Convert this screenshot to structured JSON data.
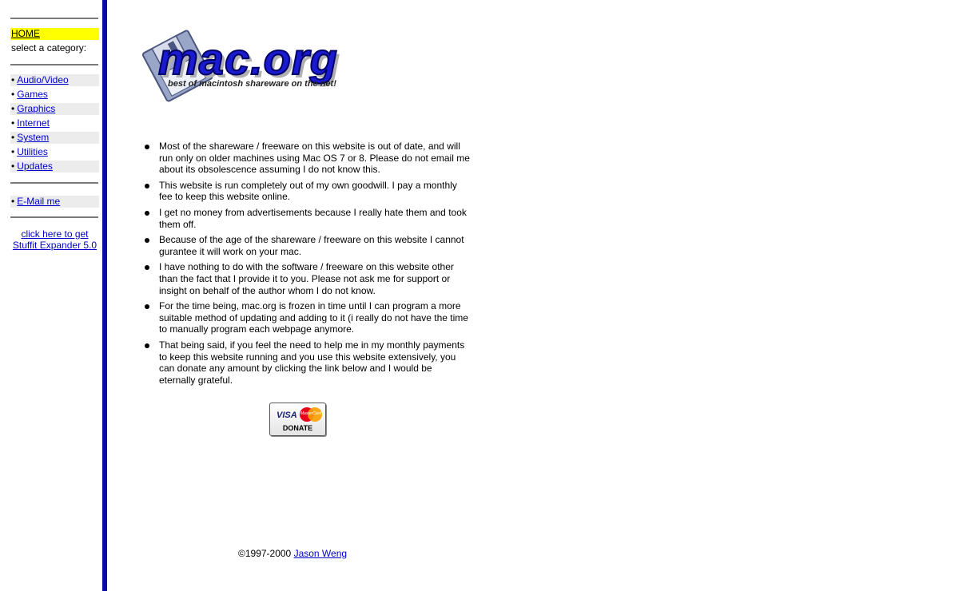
{
  "sidebar": {
    "home_label": "HOME",
    "select_label": "select a category:",
    "bullet": "•",
    "categories": [
      {
        "label": "Audio/Video"
      },
      {
        "label": "Games"
      },
      {
        "label": "Graphics"
      },
      {
        "label": "Internet"
      },
      {
        "label": "System"
      },
      {
        "label": "Utilities"
      },
      {
        "label": "Updates"
      }
    ],
    "email_label": "E-Mail me",
    "stuffit_line1": "click here to get",
    "stuffit_line2": "Stuffit Expander 5.0"
  },
  "logo": {
    "text": "mac.org",
    "tagline": "best of macintosh shareware on the net!",
    "icon": "floppy-disk-icon"
  },
  "notes": [
    "Most of the shareware / freeware on this website is out of date, and will run only on older machines using Mac OS 7 or 8. Please do not email me about its obsolescence assuming I do not know this.",
    "This website is run completely out of my own goodwill. I pay a monthly fee to keep this website online.",
    "I get no money from advertisements because I really hate them and took them off.",
    "Because of the age of the shareware / freeware on this website I cannot gurantee it will work on your mac.",
    "I have nothing to do with the software / freeware on this website other than the fact that I provide it to you. Please not ask me for support or insight on behalf of the author whom I do not know.",
    "For the time being, mac.org is frozen in time until I can program a more suitable method of updating and adding to it (i really do not have the time to manually program each webpage anymore.",
    "That being said, if you feel the need to help me in my monthly payments to keep this website running and you use this website extensively, you can donate any amount by clicking the link below and I would be eternally grateful."
  ],
  "donate": {
    "visa": "VISA",
    "mastercard": "MasterCard",
    "label": "DONATE"
  },
  "footer": {
    "copyright": "©1997-2000",
    "author": "Jason Weng"
  },
  "colors": {
    "sidebar_border": "#0a0aa8",
    "home_highlight": "#ffff00",
    "link": "#0000cc",
    "logo_blue": "#1a1ad0"
  }
}
